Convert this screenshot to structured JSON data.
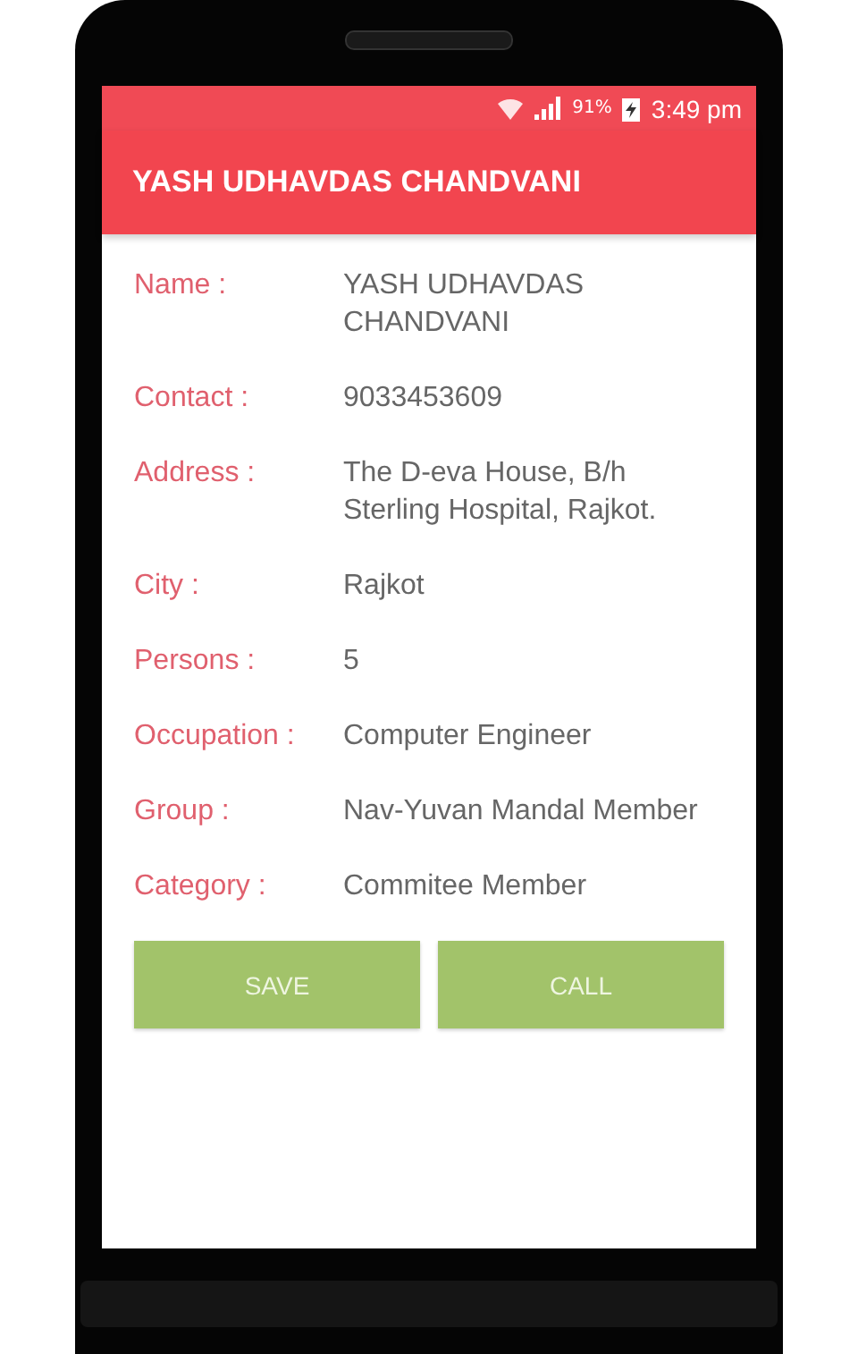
{
  "status_bar": {
    "battery": "91%",
    "time": "3:49 pm"
  },
  "app_bar": {
    "title": "YASH UDHAVDAS CHANDVANI"
  },
  "fields": [
    {
      "label": "Name :",
      "value": "YASH UDHAVDAS CHANDVANI"
    },
    {
      "label": "Contact :",
      "value": "9033453609"
    },
    {
      "label": "Address :",
      "value": "The D-eva House, B/h Sterling Hospital, Rajkot."
    },
    {
      "label": "City :",
      "value": "Rajkot"
    },
    {
      "label": "Persons :",
      "value": "5"
    },
    {
      "label": "Occupation :",
      "value": "Computer Engineer"
    },
    {
      "label": "Group :",
      "value": "Nav-Yuvan Mandal Member"
    },
    {
      "label": "Category :",
      "value": "Commitee Member"
    }
  ],
  "buttons": [
    "SAVE",
    "CALL"
  ]
}
